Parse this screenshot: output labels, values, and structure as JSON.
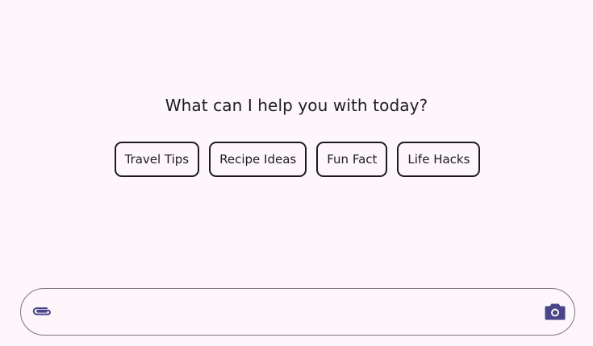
{
  "heading": "What can I help you with today?",
  "suggestions": [
    {
      "label": "Travel Tips"
    },
    {
      "label": "Recipe Ideas"
    },
    {
      "label": "Fun Fact"
    },
    {
      "label": "Life Hacks"
    }
  ],
  "composer": {
    "placeholder": "",
    "value": "",
    "attach_icon": "paperclip-icon",
    "camera_icon": "camera-icon"
  },
  "colors": {
    "background": "#fdf7fc",
    "text": "#1c1b1f",
    "outline": "#7a757f",
    "icon_accent": "#4a4489"
  }
}
